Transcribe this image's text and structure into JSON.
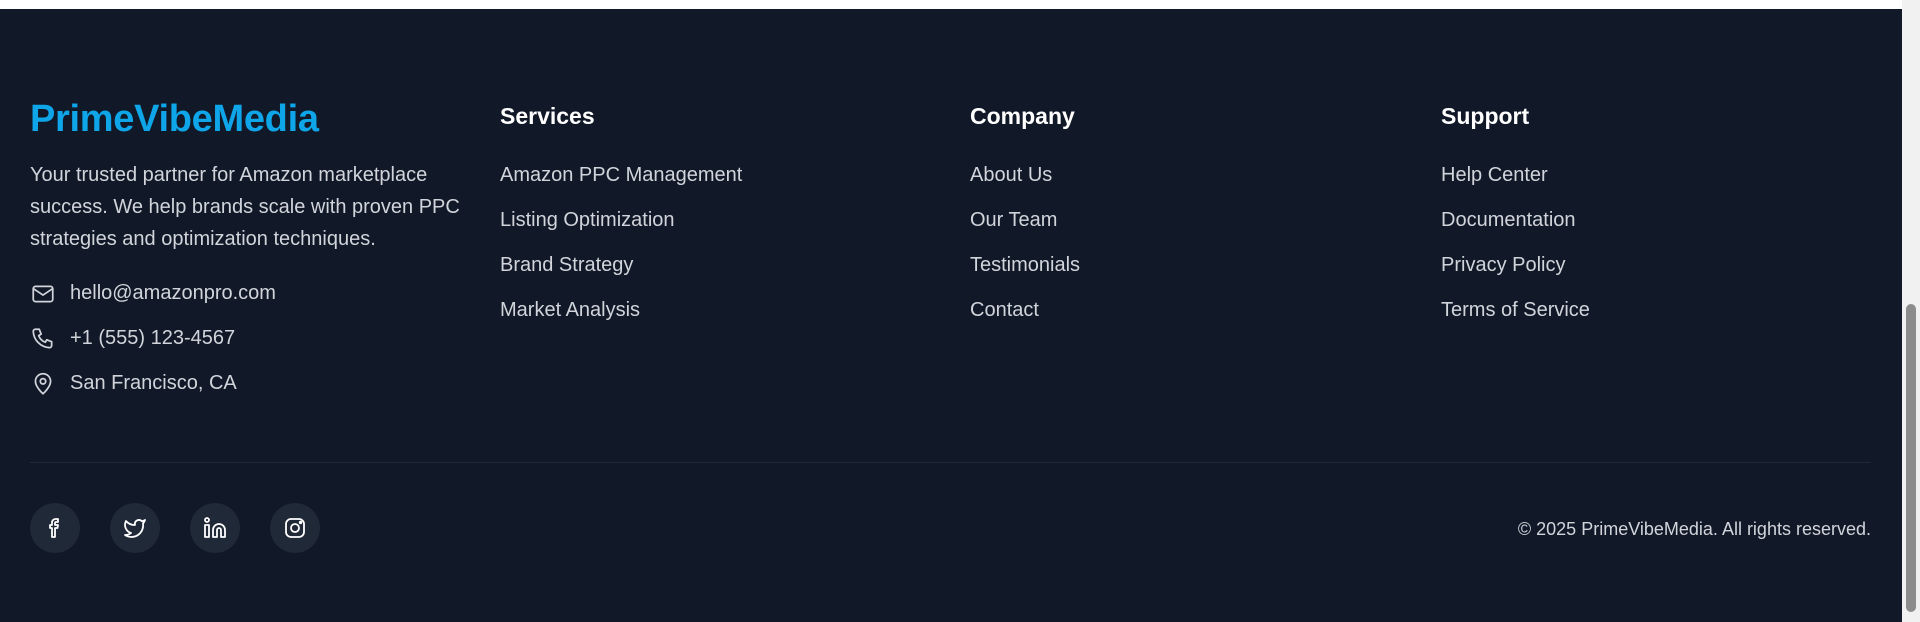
{
  "brand": {
    "name": "PrimeVibeMedia",
    "description": "Your trusted partner for Amazon marketplace success. We help brands scale with proven PPC strategies and optimization techniques.",
    "contacts": [
      {
        "icon": "mail-icon",
        "text": "hello@amazonpro.com"
      },
      {
        "icon": "phone-icon",
        "text": "+1 (555) 123-4567"
      },
      {
        "icon": "map-pin-icon",
        "text": "San Francisco, CA"
      }
    ]
  },
  "services": {
    "title": "Services",
    "links": [
      "Amazon PPC Management",
      "Listing Optimization",
      "Brand Strategy",
      "Market Analysis"
    ]
  },
  "company": {
    "title": "Company",
    "links": [
      "About Us",
      "Our Team",
      "Testimonials",
      "Contact"
    ]
  },
  "support": {
    "title": "Support",
    "links": [
      "Help Center",
      "Documentation",
      "Privacy Policy",
      "Terms of Service"
    ]
  },
  "socials": [
    "facebook-icon",
    "twitter-icon",
    "linkedin-icon",
    "instagram-icon"
  ],
  "copyright": "© 2025 PrimeVibeMedia. All rights reserved.",
  "colors": {
    "background": "#111827",
    "brand_accent": "#0ea5e9",
    "text_muted": "#d1d5db",
    "heading": "#ffffff",
    "social_bg": "#1f2937"
  }
}
